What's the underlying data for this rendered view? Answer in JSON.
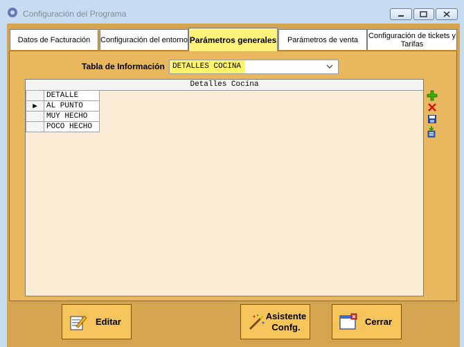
{
  "window": {
    "title": "Configuración del Programa",
    "icon": "app-gear-icon"
  },
  "tabs": [
    {
      "label": "Datos de Facturación",
      "active": false
    },
    {
      "label": "Configuración del entorno",
      "active": false
    },
    {
      "label": "Parámetros generales",
      "active": true
    },
    {
      "label": "Parámetros de venta",
      "active": false
    },
    {
      "label": "Configuración de tickets y Tarifas",
      "active": false
    }
  ],
  "tabla": {
    "label": "Tabla de Información",
    "selected": "DETALLES COCINA"
  },
  "grid": {
    "caption": "Detalles Cocina",
    "column": "DETALLE",
    "rows": [
      "AL PUNTO",
      "MUY HECHO",
      "POCO HECHO"
    ],
    "current_row_marker": "▶"
  },
  "side_actions": [
    "add-icon",
    "delete-icon",
    "save-icon",
    "import-icon"
  ],
  "buttons": {
    "editar": "Editar",
    "asistente_line1": "Asistente",
    "asistente_line2": "Confg.",
    "cerrar": "Cerrar"
  },
  "colors": {
    "panel": "#e9b85e",
    "highlight": "#fff46a",
    "button": "#f5c45a"
  }
}
